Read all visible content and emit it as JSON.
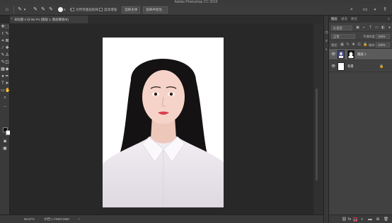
{
  "app": {
    "title": "Adobe Photoshop CC 2019"
  },
  "options_bar": {
    "brush_size": "5",
    "sample_all_layers": "对所有图层取样",
    "auto_enhance": "自动增强",
    "select_subject": "选择主体",
    "select_and_mask": "选择并遮住..."
  },
  "document": {
    "tab_label": "未标题-2 @ 66.7% (图层 1, 图层蒙版/8)",
    "zoom": "66.67%",
    "doc_size": "文档:1.74M/3.59M"
  },
  "panels": {
    "tabs": [
      "图层",
      "通道",
      "路径"
    ],
    "filter_kind": "Q 类型",
    "blend_mode": "正常",
    "opacity_label": "不透明度:",
    "opacity_value": "100%",
    "lock_label": "锁定:",
    "fill_label": "填充:",
    "fill_value": "100%"
  },
  "layers": [
    {
      "name": "图层 1",
      "selected": true,
      "has_mask": true
    },
    {
      "name": "背景",
      "selected": false,
      "locked": true
    }
  ],
  "colors": {
    "highlight": "#e0253f",
    "foreground": "#000000",
    "background": "#ffffff"
  }
}
